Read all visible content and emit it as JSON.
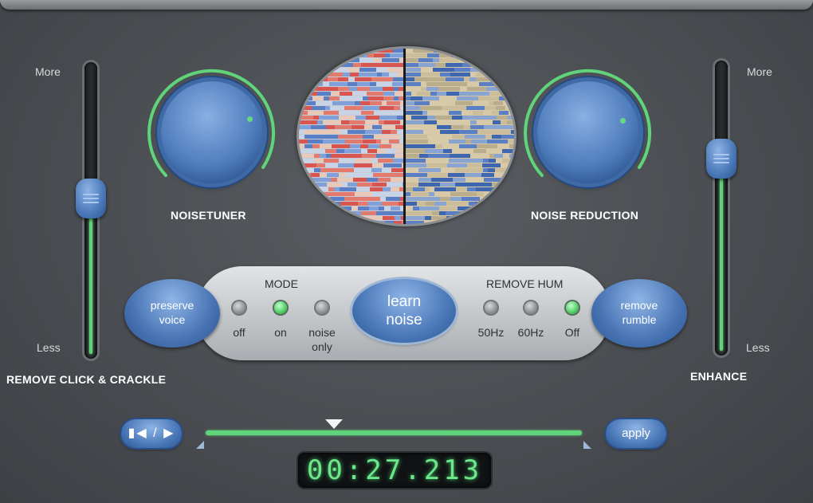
{
  "left_slider": {
    "top_label": "More",
    "bottom_label": "Less",
    "caption": "REMOVE CLICK & CRACKLE",
    "level": 0.55
  },
  "right_slider": {
    "top_label": "More",
    "bottom_label": "Less",
    "caption": "ENHANCE",
    "level": 0.68
  },
  "knobs": {
    "left_label": "NOISETUNER",
    "right_label": "NOISE REDUCTION"
  },
  "panel": {
    "preserve_voice": [
      "preserve",
      "voice"
    ],
    "remove_rumble": [
      "remove",
      "rumble"
    ],
    "learn_noise": [
      "learn",
      "noise"
    ],
    "mode": {
      "title": "MODE",
      "options": [
        {
          "label": [
            "off"
          ],
          "on": false
        },
        {
          "label": [
            "on"
          ],
          "on": true
        },
        {
          "label": [
            "noise",
            "only"
          ],
          "on": false
        }
      ]
    },
    "remove_hum": {
      "title": "REMOVE HUM",
      "options": [
        {
          "label": [
            "50Hz"
          ],
          "on": false
        },
        {
          "label": [
            "60Hz"
          ],
          "on": false
        },
        {
          "label": [
            "Off"
          ],
          "on": true
        }
      ]
    }
  },
  "transport": {
    "play_icon": "skip-back-play-icon",
    "apply_label": "apply",
    "time": "00:27.213"
  },
  "colors": {
    "accent_green": "#5fd47a",
    "knob_blue": "#4f7dbd"
  }
}
